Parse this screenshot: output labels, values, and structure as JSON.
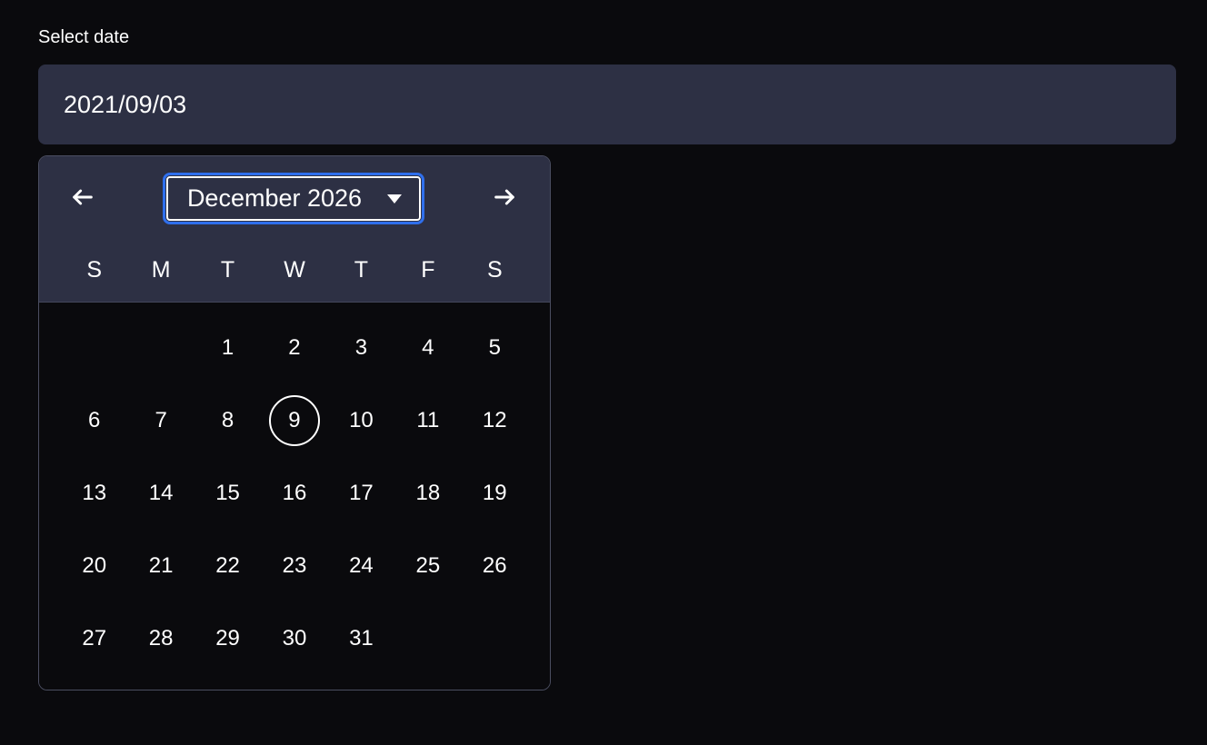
{
  "label": "Select date",
  "input_value": "2021/09/03",
  "month_year": "December 2026",
  "weekdays": [
    "S",
    "M",
    "T",
    "W",
    "T",
    "F",
    "S"
  ],
  "leading_blanks": 2,
  "days_in_month": 31,
  "today_day": 9,
  "colors": {
    "focus": "#2f6fed",
    "panel": "#2d3044",
    "border": "#4b4e61"
  },
  "icons": {
    "prev": "arrow-left-icon",
    "next": "arrow-right-icon",
    "caret": "caret-down-icon"
  }
}
